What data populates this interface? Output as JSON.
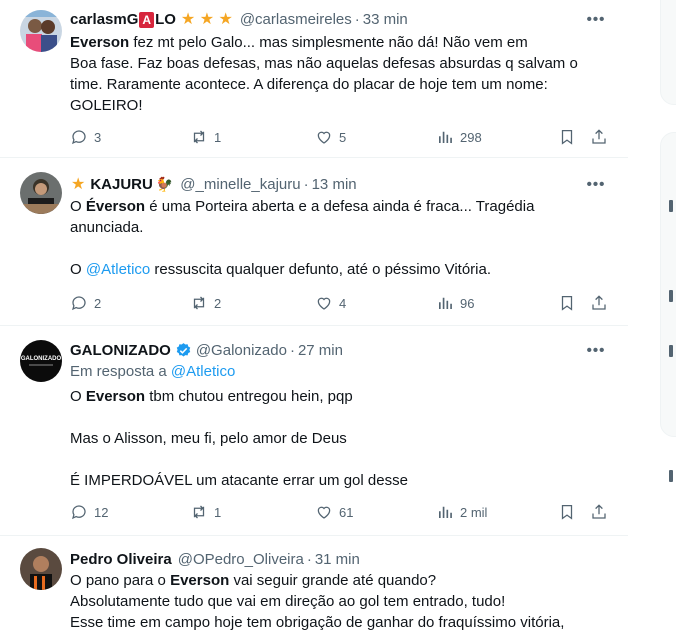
{
  "tweets": [
    {
      "name_prefix": "carlasmG",
      "name_badge": "A",
      "name_suffix": "LO",
      "stars": "★ ★ ★",
      "handle": "@carlasmeireles",
      "time": "33 min",
      "lines": [
        {
          "bold": "Everson",
          "text": " fez mt pelo Galo... mas simplesmente não dá! Não vem em"
        },
        {
          "text": "Boa fase. Faz boas defesas, mas não aquelas defesas absurdas q salvam o"
        },
        {
          "text": "time. Raramente acontece. A diferença do placar de hoje tem um nome:"
        },
        {
          "text": "GOLEIRO!"
        }
      ],
      "replies": "3",
      "reposts": "1",
      "likes": "5",
      "views": "298"
    },
    {
      "star": "★",
      "name": "KAJURU",
      "rooster": "🐓",
      "handle": "@_minelle_kajuru",
      "time": "13 min",
      "line1_pre": "O ",
      "line1_bold": "Éverson",
      "line1_post": " é uma Porteira aberta e a defesa ainda é fraca... Tragédia",
      "line2": "anunciada.",
      "line3_pre": "O ",
      "line3_mention": "@Atletico",
      "line3_post": " ressuscita qualquer defunto, até o péssimo Vitória.",
      "replies": "2",
      "reposts": "2",
      "likes": "4",
      "views": "96"
    },
    {
      "name": "GALONIZADO",
      "avatar_text": "GALONIZADO",
      "handle": "@Galonizado",
      "time": "27 min",
      "reply_prefix": "Em resposta a ",
      "reply_mention": "@Atletico",
      "line1_pre": "O ",
      "line1_bold": "Everson",
      "line1_post": " tbm chutou entregou hein, pqp",
      "line2": "Mas o Alisson, meu fi, pelo amor de Deus",
      "line3": "É IMPERDOÁVEL um atacante errar um gol desse",
      "replies": "12",
      "reposts": "1",
      "likes": "61",
      "views": "2 mil"
    },
    {
      "name": "Pedro Oliveira",
      "handle": "@OPedro_Oliveira",
      "time": "31 min",
      "line1_pre": "O pano para o ",
      "line1_bold": "Everson",
      "line1_post": " vai seguir grande até quando?",
      "line2": "Absolutamente tudo que vai em direção ao gol tem entrado, tudo!",
      "line3": "Esse time em campo hoje tem obrigação de ganhar do fraquíssimo vitória,"
    }
  ],
  "more_label": "•••",
  "dot": "·",
  "colors": {
    "accent": "#1d9bf0",
    "muted": "#536471",
    "text": "#0f1419",
    "star": "#f5a623",
    "badge": "#d7263d"
  }
}
